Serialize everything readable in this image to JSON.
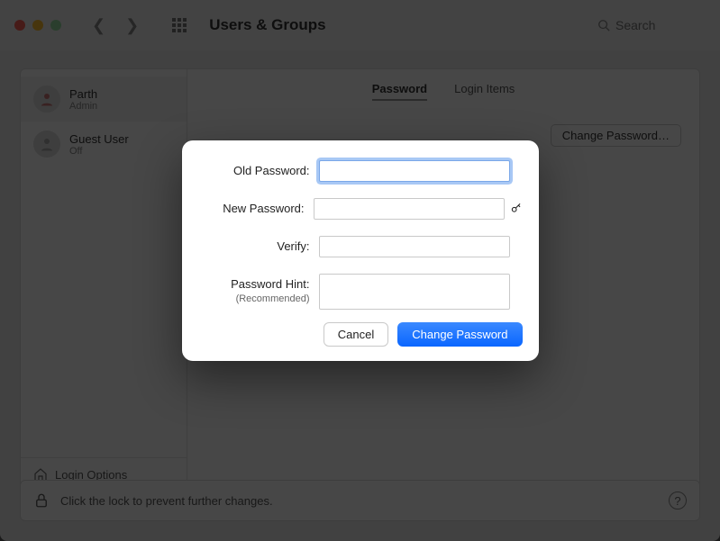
{
  "window": {
    "title": "Users & Groups",
    "search_placeholder": "Search"
  },
  "tabs": {
    "password": "Password",
    "login_items": "Login Items"
  },
  "sidebar": {
    "users": [
      {
        "name": "Parth",
        "role": "Admin"
      },
      {
        "name": "Guest User",
        "role": "Off"
      }
    ],
    "login_options": "Login Options"
  },
  "background_actions": {
    "change_password": "Change Password…"
  },
  "footer": {
    "lock_text": "Click the lock to prevent further changes."
  },
  "modal": {
    "labels": {
      "old_password": "Old Password:",
      "new_password": "New Password:",
      "verify": "Verify:",
      "hint": "Password Hint:",
      "hint_sub": "(Recommended)"
    },
    "fields": {
      "old_password": "",
      "new_password": "",
      "verify": "",
      "hint": ""
    },
    "buttons": {
      "cancel": "Cancel",
      "change": "Change Password"
    }
  }
}
